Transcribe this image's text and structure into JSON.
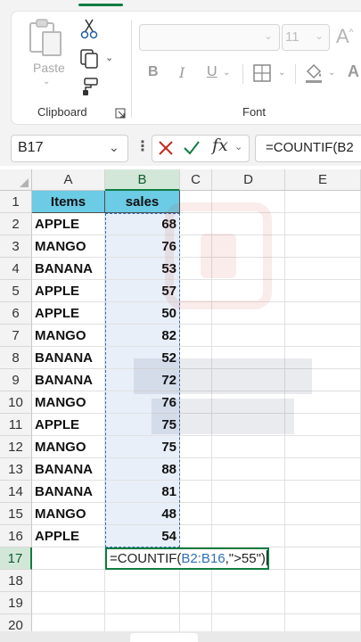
{
  "ribbon": {
    "clipboard": {
      "paste_label": "Paste",
      "group_label": "Clipboard"
    },
    "font": {
      "font_size": "11",
      "bold": "B",
      "italic": "I",
      "underline": "U",
      "group_label": "Font"
    }
  },
  "formula_bar": {
    "name_box": "B17",
    "formula": "=COUNTIF(B2"
  },
  "grid": {
    "columns": [
      "A",
      "B",
      "C",
      "D",
      "E"
    ],
    "rows": [
      "1",
      "2",
      "3",
      "4",
      "5",
      "6",
      "7",
      "8",
      "9",
      "10",
      "11",
      "12",
      "13",
      "14",
      "15",
      "16",
      "17",
      "18",
      "19",
      "20"
    ],
    "headers": {
      "items": "Items",
      "sales": "sales"
    },
    "data": [
      {
        "item": "APPLE",
        "sales": "68"
      },
      {
        "item": "MANGO",
        "sales": "76"
      },
      {
        "item": "BANANA",
        "sales": "53"
      },
      {
        "item": "APPLE",
        "sales": "57"
      },
      {
        "item": "APPLE",
        "sales": "50"
      },
      {
        "item": "MANGO",
        "sales": "82"
      },
      {
        "item": "BANANA",
        "sales": "52"
      },
      {
        "item": "BANANA",
        "sales": "72"
      },
      {
        "item": "MANGO",
        "sales": "76"
      },
      {
        "item": "APPLE",
        "sales": "75"
      },
      {
        "item": "MANGO",
        "sales": "75"
      },
      {
        "item": "BANANA",
        "sales": "88"
      },
      {
        "item": "BANANA",
        "sales": "81"
      },
      {
        "item": "MANGO",
        "sales": "48"
      },
      {
        "item": "APPLE",
        "sales": "54"
      }
    ],
    "edit_cell": {
      "prefix": "=COUNTIF(",
      "range": "B2:B16",
      "suffix": ",\">55\")"
    }
  },
  "colors": {
    "header_fill": "#6ccbe5",
    "selection_fill": "#e8eff8",
    "accent_green": "#107c41",
    "range_blue": "#2f6fb3"
  }
}
